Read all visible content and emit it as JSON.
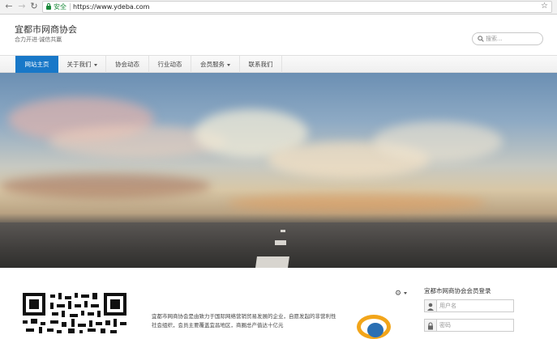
{
  "browser": {
    "secure_label": "安全",
    "url": "https://www.ydeba.com"
  },
  "header": {
    "title": "宜都市网商协会",
    "slogan": "合力开进·诚信共赢",
    "search": {
      "placeholder": "搜索..."
    }
  },
  "nav": {
    "items": [
      {
        "label": "网站主页",
        "active": true,
        "dropdown": false
      },
      {
        "label": "关于我们",
        "active": false,
        "dropdown": true
      },
      {
        "label": "协会动态",
        "active": false,
        "dropdown": false
      },
      {
        "label": "行业动态",
        "active": false,
        "dropdown": false
      },
      {
        "label": "会员服务",
        "active": false,
        "dropdown": true
      },
      {
        "label": "联系我们",
        "active": false,
        "dropdown": false
      }
    ]
  },
  "intro": {
    "text": "宜都市网商协会是由致力于国际网络营销贸易发展的企业，自愿发起的非营利性社会组织，会员主要覆盖宜昌地区，商圈总产值达十亿元"
  },
  "login": {
    "title": "宜都市网商协会会员登录",
    "username_placeholder": "用户名",
    "password_placeholder": "密码"
  },
  "colors": {
    "nav_active": "#1878c8",
    "secure_green": "#1a8a3a",
    "badge_orange": "#f2a51a"
  },
  "icons": [
    "back-icon",
    "forward-icon",
    "reload-icon",
    "lock-icon",
    "star-icon",
    "search-icon",
    "gear-icon",
    "user-icon",
    "password-lock-icon"
  ]
}
